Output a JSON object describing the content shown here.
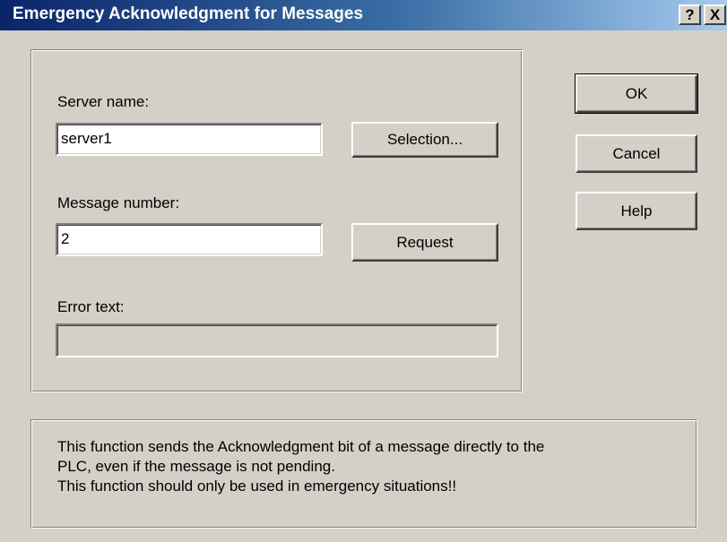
{
  "window": {
    "title": "Emergency Acknowledgment for Messages",
    "help_glyph": "?",
    "close_glyph": "X"
  },
  "server": {
    "label": "Server name:",
    "value": "server1",
    "selection_button": "Selection..."
  },
  "message": {
    "label": "Message number:",
    "value": "2",
    "request_button": "Request"
  },
  "error": {
    "label": "Error text:",
    "value": ""
  },
  "buttons": {
    "ok": "OK",
    "cancel": "Cancel",
    "help": "Help"
  },
  "info": {
    "lines": [
      "This function sends the Acknowledgment bit of a message directly to the",
      "PLC, even if the message is not pending.",
      "This function should only be used in emergency situations!!"
    ]
  },
  "colors": {
    "dialog_bg": "#d4d0c8",
    "titlebar_start": "#0a246a",
    "titlebar_end": "#a6caf0"
  }
}
